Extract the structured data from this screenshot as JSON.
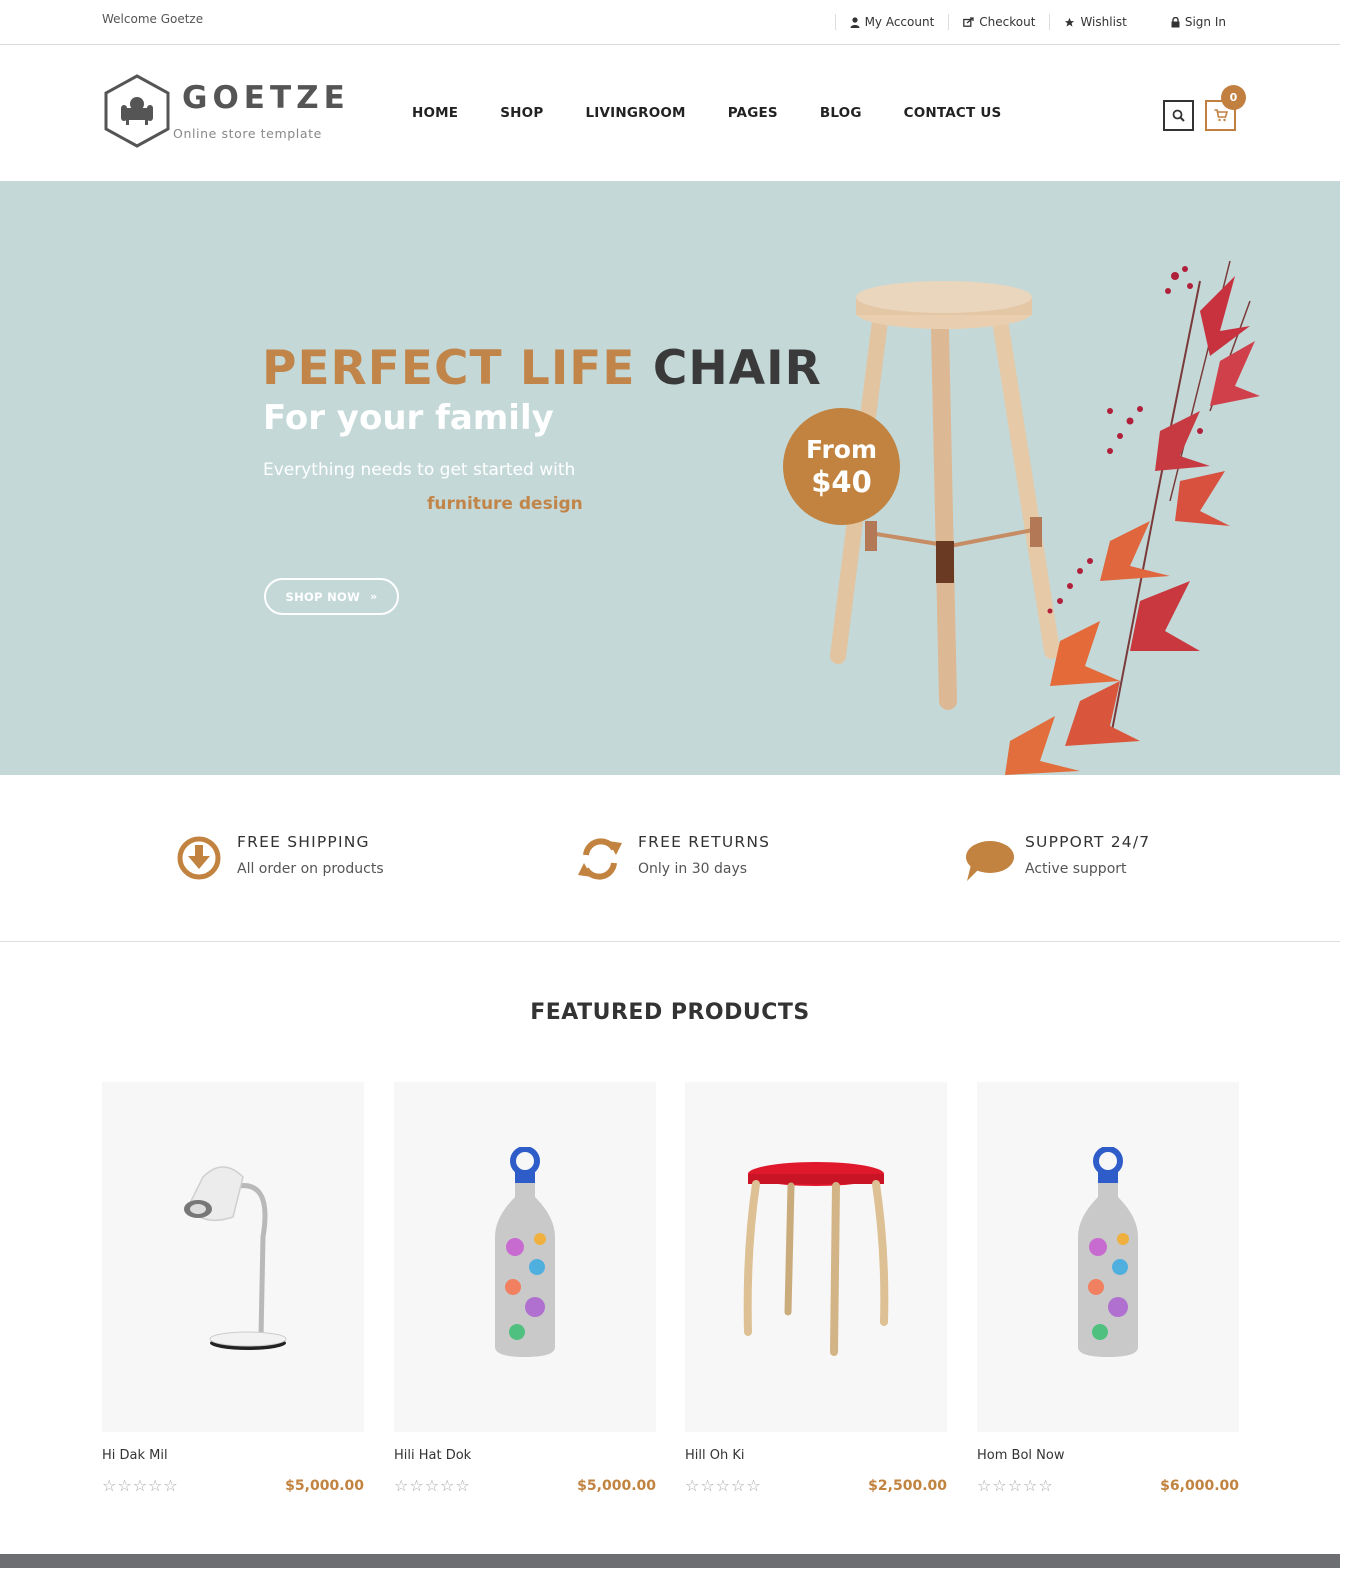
{
  "topbar": {
    "welcome": "Welcome Goetze",
    "links": [
      {
        "label": "My Account",
        "icon": "user-icon"
      },
      {
        "label": "Checkout",
        "icon": "share-icon"
      },
      {
        "label": "Wishlist",
        "icon": "star-icon"
      },
      {
        "label": "Sign In",
        "icon": "lock-icon"
      }
    ]
  },
  "header": {
    "logo_name": "GOETZE",
    "logo_tagline": "Online store template",
    "nav": [
      "HOME",
      "SHOP",
      "LIVINGROOM",
      "PAGES",
      "BLOG",
      "CONTACT US"
    ],
    "cart_count": "0"
  },
  "hero": {
    "title_accent": "PERFECT LIFE",
    "title_dark": "CHAIR",
    "subtitle": "For your family",
    "description": "Everything needs to get started with",
    "accent_text": "furniture design",
    "button_label": "SHOP NOW",
    "button_icon": "»",
    "badge_from": "From",
    "badge_price": "$40"
  },
  "features": [
    {
      "title": "FREE SHIPPING",
      "desc": "All order on products",
      "icon": "download-circle-icon"
    },
    {
      "title": "FREE RETURNS",
      "desc": "Only in 30 days",
      "icon": "refresh-icon"
    },
    {
      "title": "SUPPORT 24/7",
      "desc": "Active support",
      "icon": "chat-bubble-icon"
    }
  ],
  "featured": {
    "title": "FEATURED PRODUCTS",
    "products": [
      {
        "name": "Hi Dak Mil",
        "price": "$5,000.00",
        "stars": "☆☆☆☆☆",
        "image": "desk-lamp"
      },
      {
        "name": "Hili Hat Dok",
        "price": "$5,000.00",
        "stars": "☆☆☆☆☆",
        "image": "floral-bottle"
      },
      {
        "name": "Hill Oh Ki",
        "price": "$2,500.00",
        "stars": "☆☆☆☆☆",
        "image": "red-stool"
      },
      {
        "name": "Hom Bol Now",
        "price": "$6,000.00",
        "stars": "☆☆☆☆☆",
        "image": "floral-bottle"
      }
    ]
  },
  "colors": {
    "accent": "#c1833f",
    "hero_bg": "#c4d8d8",
    "text_dark": "#333333"
  }
}
